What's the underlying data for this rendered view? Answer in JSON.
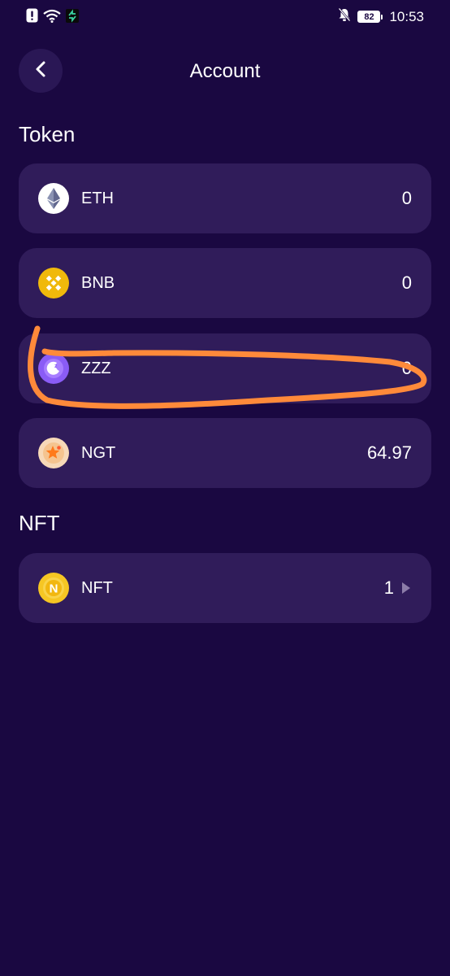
{
  "status_bar": {
    "time": "10:53",
    "battery": "82"
  },
  "header": {
    "title": "Account"
  },
  "token_section": {
    "title": "Token",
    "items": [
      {
        "name": "ETH",
        "amount": "0",
        "icon": "eth-icon"
      },
      {
        "name": "BNB",
        "amount": "0",
        "icon": "bnb-icon"
      },
      {
        "name": "ZZZ",
        "amount": "0",
        "icon": "zzz-moon-icon"
      },
      {
        "name": "NGT",
        "amount": "64.97",
        "icon": "ngt-star-icon"
      }
    ]
  },
  "nft_section": {
    "title": "NFT",
    "items": [
      {
        "name": "NFT",
        "amount": "1",
        "icon": "nft-coin-icon"
      }
    ]
  },
  "colors": {
    "background": "#1a0841",
    "card": "#301c5a",
    "annotation": "#ff8a3a"
  }
}
